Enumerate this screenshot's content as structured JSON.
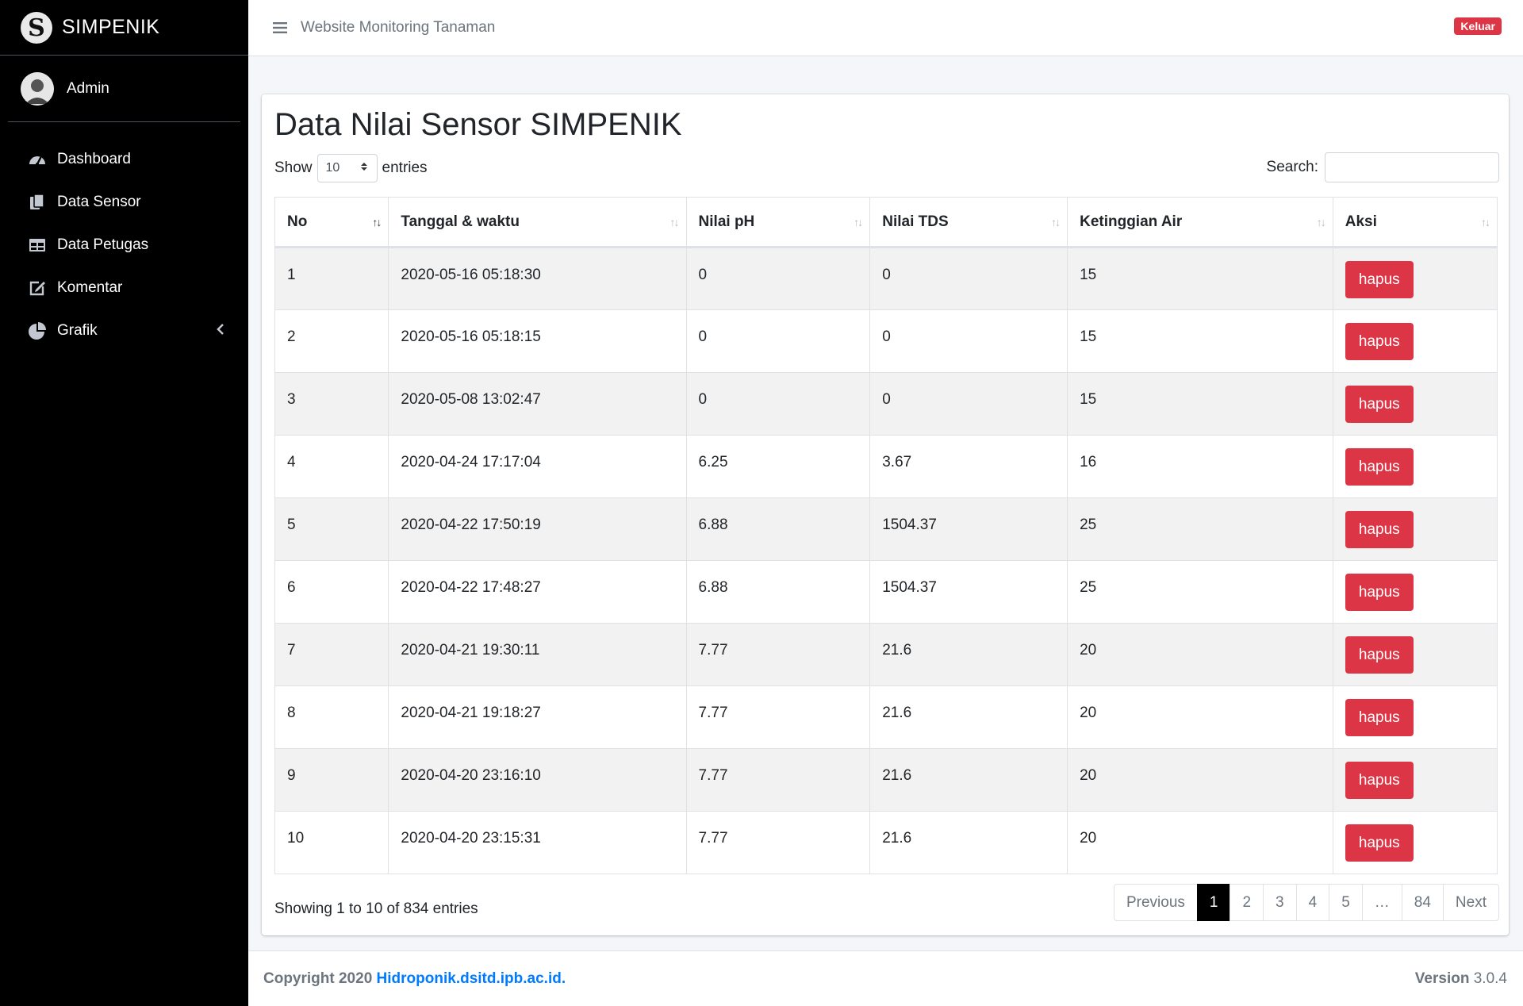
{
  "brand": {
    "name": "SIMPENIK"
  },
  "user": {
    "name": "Admin"
  },
  "sidebar": {
    "items": [
      {
        "label": "Dashboard",
        "icon": "tachometer-icon"
      },
      {
        "label": "Data Sensor",
        "icon": "copy-icon"
      },
      {
        "label": "Data Petugas",
        "icon": "table-icon"
      },
      {
        "label": "Komentar",
        "icon": "edit-icon"
      },
      {
        "label": "Grafik",
        "icon": "pie-chart-icon"
      }
    ]
  },
  "header": {
    "title": "Website Monitoring Tanaman",
    "logout_label": "Keluar"
  },
  "main": {
    "title": "Data Nilai Sensor SIMPENIK",
    "length": {
      "prefix": "Show",
      "value": "10",
      "suffix": "entries"
    },
    "search_label": "Search:",
    "table": {
      "columns": [
        "No",
        "Tanggal & waktu",
        "Nilai pH",
        "Nilai TDS",
        "Ketinggian Air",
        "Aksi"
      ],
      "rows": [
        [
          "1",
          "2020-05-16 05:18:30",
          "0",
          "0",
          "15"
        ],
        [
          "2",
          "2020-05-16 05:18:15",
          "0",
          "0",
          "15"
        ],
        [
          "3",
          "2020-05-08 13:02:47",
          "0",
          "0",
          "15"
        ],
        [
          "4",
          "2020-04-24 17:17:04",
          "6.25",
          "3.67",
          "16"
        ],
        [
          "5",
          "2020-04-22 17:50:19",
          "6.88",
          "1504.37",
          "25"
        ],
        [
          "6",
          "2020-04-22 17:48:27",
          "6.88",
          "1504.37",
          "25"
        ],
        [
          "7",
          "2020-04-21 19:30:11",
          "7.77",
          "21.6",
          "20"
        ],
        [
          "8",
          "2020-04-21 19:18:27",
          "7.77",
          "21.6",
          "20"
        ],
        [
          "9",
          "2020-04-20 23:16:10",
          "7.77",
          "21.6",
          "20"
        ],
        [
          "10",
          "2020-04-20 23:15:31",
          "7.77",
          "21.6",
          "20"
        ]
      ],
      "action_label": "hapus"
    },
    "info": "Showing 1 to 10 of 834 entries",
    "pagination": [
      "Previous",
      "1",
      "2",
      "3",
      "4",
      "5",
      "…",
      "84",
      "Next"
    ],
    "active_page": "1"
  },
  "footer": {
    "copyright_prefix": "Copyright 2020",
    "link_text": "Hidroponik.dsitd.ipb.ac.id",
    "link_suffix": ".",
    "version_label": "Version",
    "version_value": "3.0.4"
  },
  "colors": {
    "danger": "#dc3545",
    "sidebar": "#000000",
    "link": "#007bff"
  }
}
